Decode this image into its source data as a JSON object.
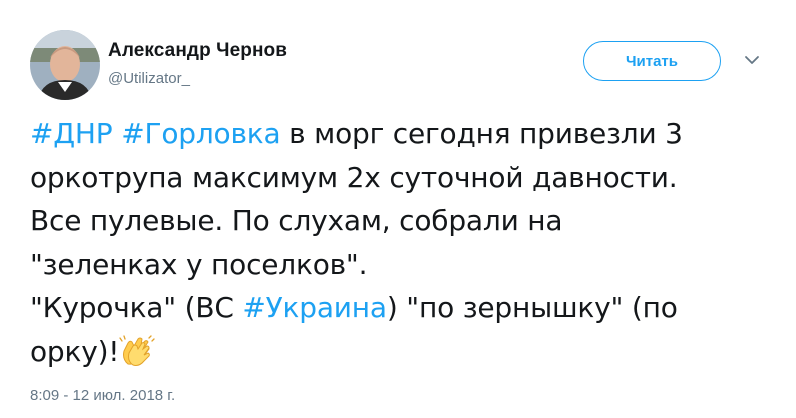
{
  "author": {
    "name": "Александр Чернов",
    "handle": "@Utilizator_"
  },
  "follow_button": {
    "label": "Читать"
  },
  "tweet": {
    "line1": {
      "tag1": "#ДНР",
      "tag2": "#Горловка",
      "rest": " в морг сегодня привезли 3"
    },
    "line2": "оркотрупа максимум 2х суточной давности.",
    "line3": "Все пулевые. По слухам, собрали на",
    "line4": "\"зеленках у поселков\".",
    "line5": {
      "before": "\"Курочка\" (ВС ",
      "tag": "#Украина",
      "after": ") \"по зернышку\" (по"
    },
    "line6": "орку)!"
  },
  "timestamp": "8:09 - 12 июл. 2018 г.",
  "icons": {
    "caret": "chevron-down-icon",
    "emoji": "clapping-hands-icon"
  },
  "colors": {
    "link": "#1da1f2",
    "secondary_text": "#657786",
    "primary_text": "#14171a"
  }
}
